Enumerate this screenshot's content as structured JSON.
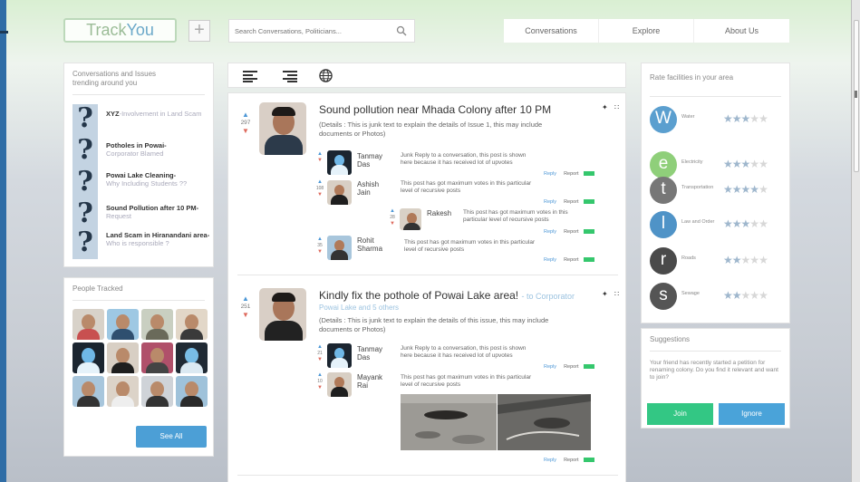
{
  "app": {
    "logo_part1": "Track",
    "logo_part2": "You",
    "plus": "+"
  },
  "search": {
    "placeholder": "Search Conversations, Politicians..."
  },
  "nav": {
    "items": [
      "Conversations",
      "Explore",
      "About Us"
    ]
  },
  "trending": {
    "title": "Conversations and Issues trending around you",
    "items": [
      {
        "title": "XYZ",
        "sub": "-Involvement in Land Scam"
      },
      {
        "title": "Potholes in Powai-",
        "sub": "Corporator Blamed"
      },
      {
        "title": "Powai Lake Cleaning-",
        "sub": "Why Including Students ??"
      },
      {
        "title": "Sound Pollution after 10 PM-",
        "sub": "Request"
      },
      {
        "title": "Land Scam in Hiranandani area-",
        "sub": "Who is responsible ?"
      }
    ]
  },
  "people": {
    "title": "People Tracked",
    "see_all": "See All",
    "photo_count": 12
  },
  "colors": {
    "accent_blue": "#4c9fd6",
    "upvote": "#4c97d6",
    "downvote": "#de6a5d",
    "green": "#33c784",
    "rating_w": "#5b9fcf",
    "rating_e": "#8fcf7a",
    "rating_t": "#777777",
    "rating_l": "#4f93c7",
    "rating_r": "#4a4a4a",
    "rating_s": "#555555"
  },
  "toolbar": {
    "icons": [
      "list-icon",
      "compact-list-icon",
      "globe-icon"
    ]
  },
  "post1": {
    "title": "Sound pollution near Mhada Colony after 10 PM",
    "details": "(Details : This is junk text to explain the details of Issue 1, this may include documents or Photos)",
    "votes": "297",
    "comments": [
      {
        "name": "Tanmay Das",
        "votes": "",
        "text": "Junk Reply to a conversation, this post is shown here because it has received lot of upvotes",
        "reply": "Reply",
        "report": "Report"
      },
      {
        "name": "Ashish Jain",
        "votes": "108",
        "text": "This post has got maximum votes in this particular level of recursive posts",
        "reply": "Reply",
        "report": "Report"
      },
      {
        "name": "Rakesh",
        "votes": "28",
        "text": "This post has got maximum votes in this particular level of recursive posts",
        "reply": "Reply",
        "report": "Report"
      },
      {
        "name": "Rohit Sharma",
        "votes": "35",
        "text": "This post has got maximum votes in this particular level of recursive posts",
        "reply": "Reply",
        "report": "Report"
      }
    ]
  },
  "post2": {
    "title": "Kindly fix the pothole of Powai Lake area!",
    "to": "- to Corporator",
    "subtitle": "Powai Lake and 5 others",
    "details": "(Details : This is junk text to explain the details of this issue, this may include documents or Photos)",
    "votes": "251",
    "comments": [
      {
        "name": "Tanmay Das",
        "votes": "21",
        "text": "Junk Reply to a conversation, this post is shown here because it has received lot of upvotes",
        "reply": "Reply",
        "report": "Report"
      },
      {
        "name": "Mayank Rai",
        "votes": "10",
        "text": "This post has got maximum votes in this particular level of recursive posts",
        "reply": "Reply",
        "report": "Report"
      }
    ],
    "bottom_reply": "Reply",
    "bottom_report": "Report"
  },
  "rate": {
    "title": "Rate facilities in your area",
    "items": [
      {
        "letter": "W",
        "label": "Water",
        "rating": 3
      },
      {
        "letter": "e",
        "label": "Electricity",
        "rating": 3
      },
      {
        "letter": "t",
        "label": "Transportation",
        "rating": 4
      },
      {
        "letter": "l",
        "label": "Law and Order",
        "rating": 3
      },
      {
        "letter": "r",
        "label": "Roads",
        "rating": 2
      },
      {
        "letter": "s",
        "label": "Sewage",
        "rating": 2
      }
    ]
  },
  "suggestions": {
    "title": "Suggestions",
    "text": "Your friend has recently started a petition for renaming colony. Do you find it relevant and want to join?",
    "join": "Join",
    "ignore": "Ignore"
  }
}
